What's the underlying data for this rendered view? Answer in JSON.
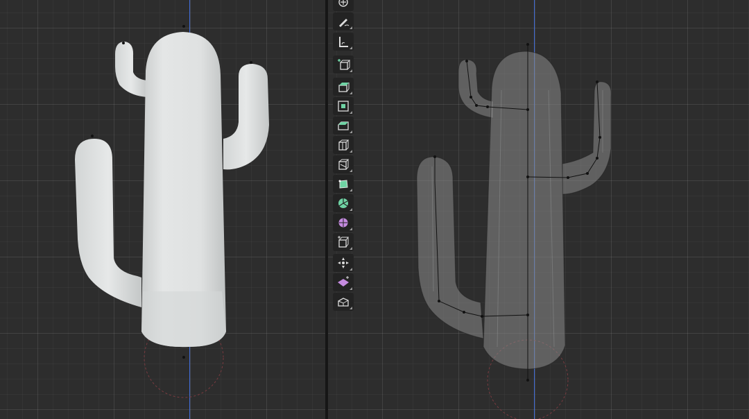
{
  "app": "Blender",
  "colors": {
    "viewport_bg": "#2d2d2d",
    "grid_line": "#3a3a3a",
    "z_axis": "#3f6bd6",
    "solid_mesh": "#d9dcdc",
    "xray_mesh": "#6e6f6f",
    "armature_bone": "#111111",
    "cursor_circle": "#7a3b40",
    "tool_active": "#6fd3a4"
  },
  "viewports": {
    "left": {
      "name": "solid-view",
      "object": "cactus-mesh",
      "shading": "solid"
    },
    "right": {
      "name": "xray-view",
      "object": "cactus-mesh-with-armature",
      "shading": "x-ray"
    }
  },
  "toolbar": {
    "tools": [
      {
        "id": "transform",
        "icon": "transform-icon"
      },
      {
        "id": "annotate",
        "icon": "annotate-icon"
      },
      {
        "id": "measure",
        "icon": "measure-icon"
      },
      {
        "id": "add-cube",
        "icon": "add-cube-icon"
      },
      {
        "id": "extrude-region",
        "icon": "extrude-icon"
      },
      {
        "id": "inset-faces",
        "icon": "inset-icon"
      },
      {
        "id": "bevel",
        "icon": "bevel-icon"
      },
      {
        "id": "loop-cut",
        "icon": "loop-cut-icon"
      },
      {
        "id": "knife",
        "icon": "knife-icon"
      },
      {
        "id": "poly-build",
        "icon": "poly-build-icon"
      },
      {
        "id": "spin",
        "icon": "spin-icon"
      },
      {
        "id": "smooth",
        "icon": "smooth-icon"
      },
      {
        "id": "edge-slide",
        "icon": "edge-slide-icon"
      },
      {
        "id": "shrink-fatten",
        "icon": "shrink-fatten-icon"
      },
      {
        "id": "shear",
        "icon": "shear-icon"
      },
      {
        "id": "rip-region",
        "icon": "rip-icon"
      }
    ]
  }
}
